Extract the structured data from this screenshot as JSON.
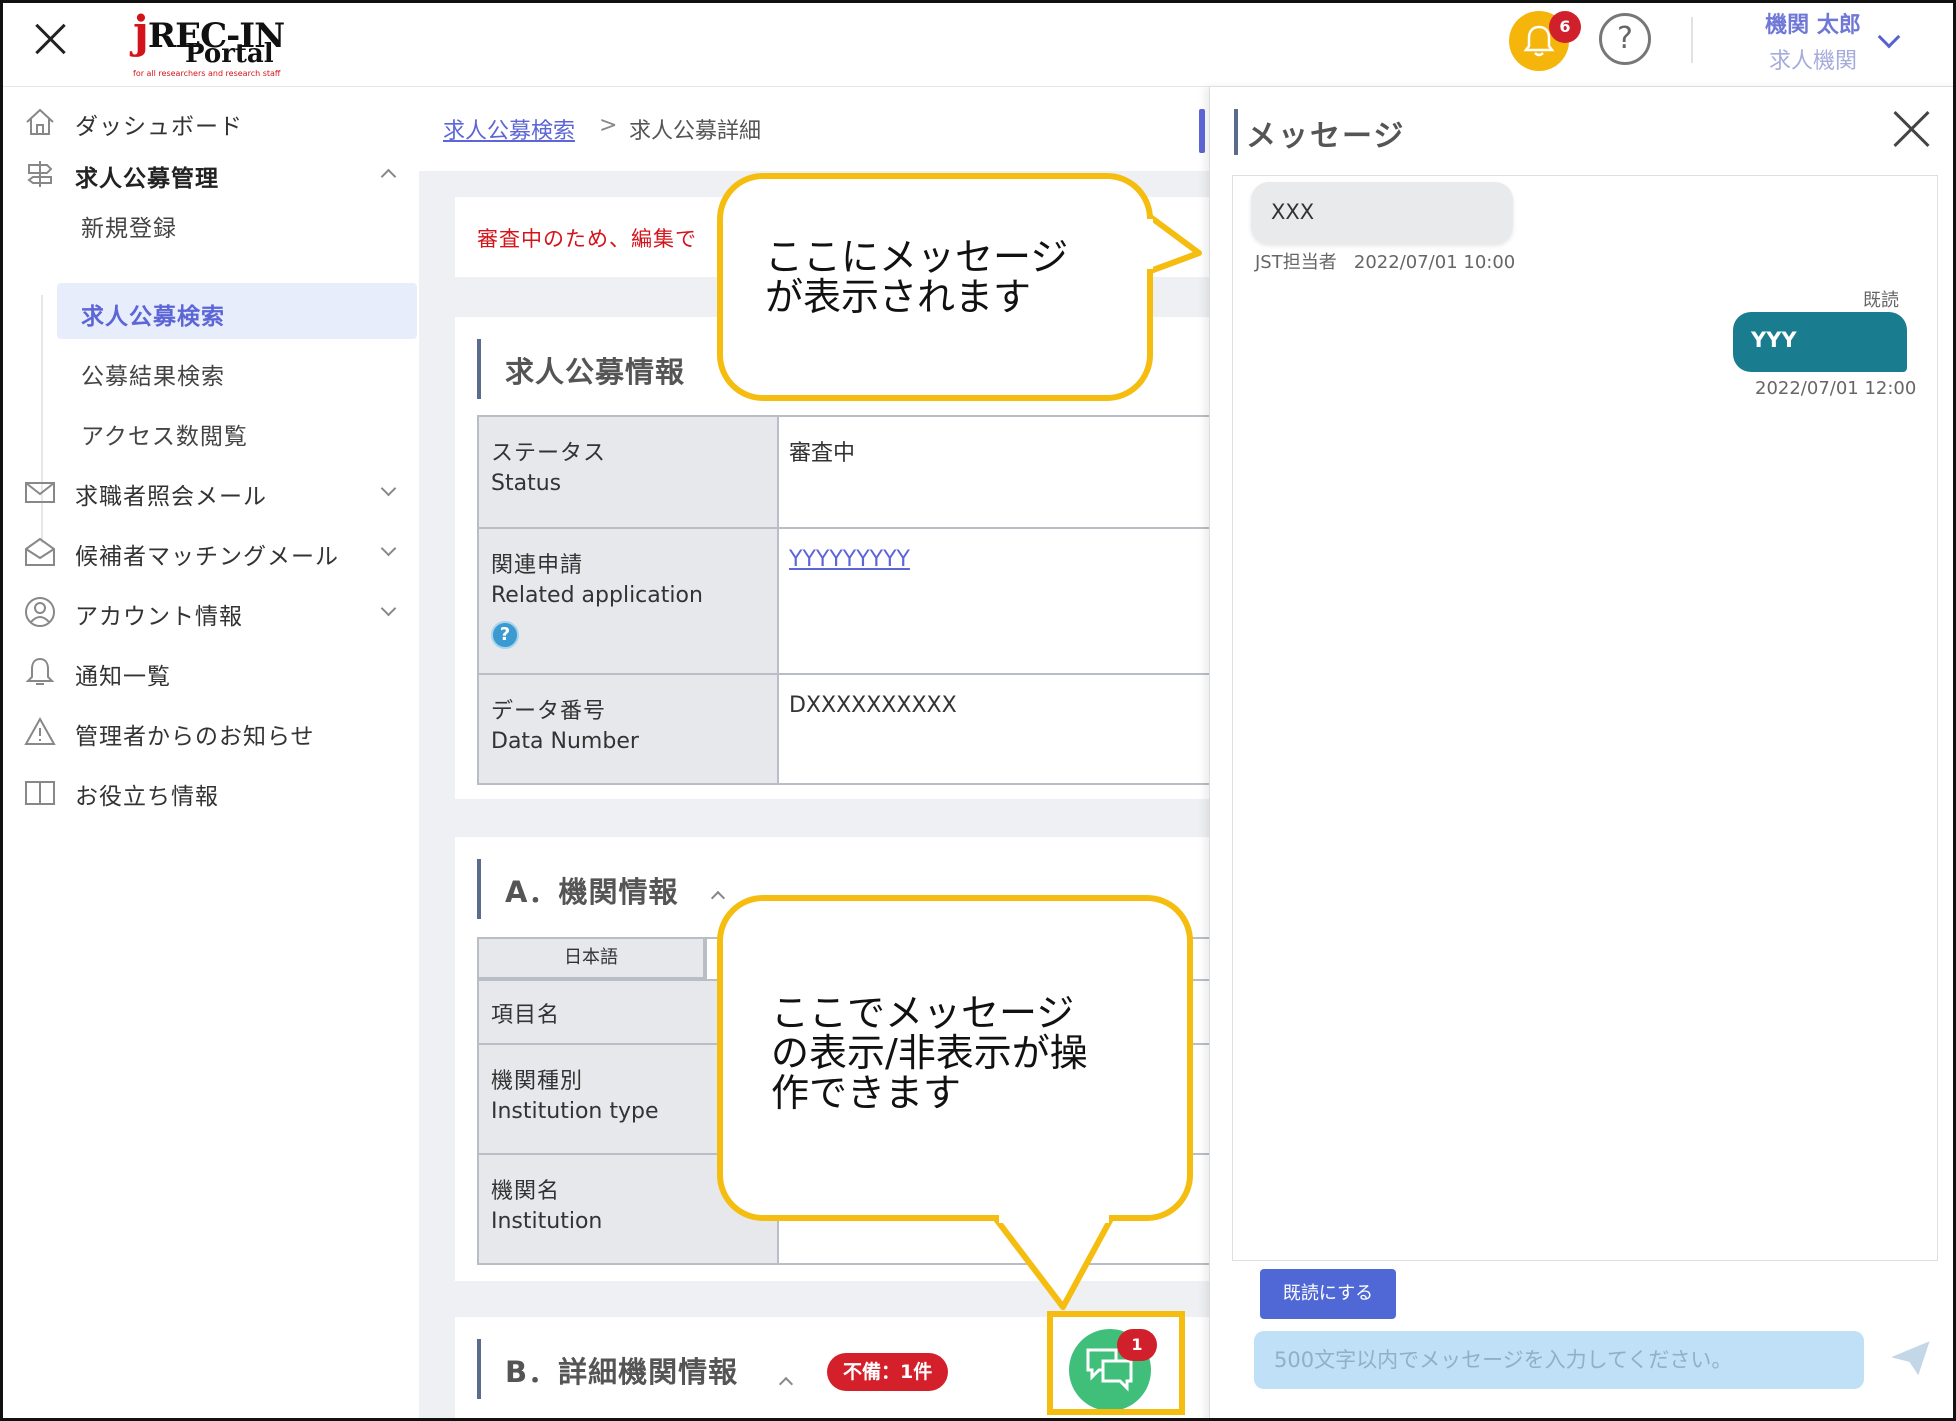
{
  "header": {
    "logo_main": "REC-IN",
    "logo_j": "j",
    "logo_sub": "Portal",
    "logo_tagline": "for all researchers and research staff",
    "notification_count": "6",
    "help_label": "?",
    "user_name": "機関 太郎",
    "user_role": "求人機関"
  },
  "sidebar": {
    "items": [
      {
        "label": "ダッシュボード",
        "icon": "home-icon"
      },
      {
        "label": "求人公募管理",
        "icon": "signpost-icon"
      },
      {
        "label": "求職者照会メール",
        "icon": "mail-icon"
      },
      {
        "label": "候補者マッチングメール",
        "icon": "open-mail-icon"
      },
      {
        "label": "アカウント情報",
        "icon": "user-icon"
      },
      {
        "label": "通知一覧",
        "icon": "bell-icon"
      },
      {
        "label": "管理者からのお知らせ",
        "icon": "warning-icon"
      },
      {
        "label": "お役立ち情報",
        "icon": "book-icon"
      }
    ],
    "sub_items": [
      {
        "label": "新規登録"
      },
      {
        "label": "求人公募検索"
      },
      {
        "label": "公募結果検索"
      },
      {
        "label": "アクセス数閲覧"
      }
    ]
  },
  "main": {
    "breadcrumb_link": "求人公募検索",
    "breadcrumb_sep": ">",
    "breadcrumb_current": "求人公募詳細",
    "alert": "審査中のため、編集で",
    "section_info": {
      "title": "求人公募情報",
      "rows": [
        {
          "ja": "ステータス",
          "en": "Status",
          "value": "審査中"
        },
        {
          "ja": "関連申請",
          "en": "Related application",
          "value": "YYYYYYYYY"
        },
        {
          "ja": "データ番号",
          "en": "Data Number",
          "value": "DXXXXXXXXXX"
        }
      ]
    },
    "section_a": {
      "title": "A．機関情報",
      "lang_tab": "日本語",
      "rows": [
        {
          "ja": "項目名",
          "en": ""
        },
        {
          "ja": "機関種別",
          "en": "Institution type"
        },
        {
          "ja": "機関名",
          "en": "Institution"
        }
      ]
    },
    "section_b": {
      "title": "B．詳細機関情報",
      "badge": "不備：1件"
    },
    "chat_fab_count": "1"
  },
  "message_panel": {
    "title": "メッセージ",
    "incoming": {
      "text": "XXX",
      "sender": "JST担当者",
      "time": "2022/07/01 10:00"
    },
    "outgoing": {
      "read_label": "既読",
      "text": "YYY",
      "time": "2022/07/01 12:00"
    },
    "mark_read_label": "既読にする",
    "input_placeholder": "500文字以内でメッセージを入力してください。"
  },
  "callouts": {
    "top": [
      "ここにメッセージ",
      "が表示されます"
    ],
    "bottom": [
      "ここでメッセージ",
      "の表示/非表示が操",
      "作できます"
    ]
  },
  "colors": {
    "accent": "#5d66d6",
    "callout_border": "#f5bd10",
    "alert": "#d4141b",
    "chat_fab": "#3fbf7a",
    "outgoing_bubble": "#1a7d8f"
  }
}
